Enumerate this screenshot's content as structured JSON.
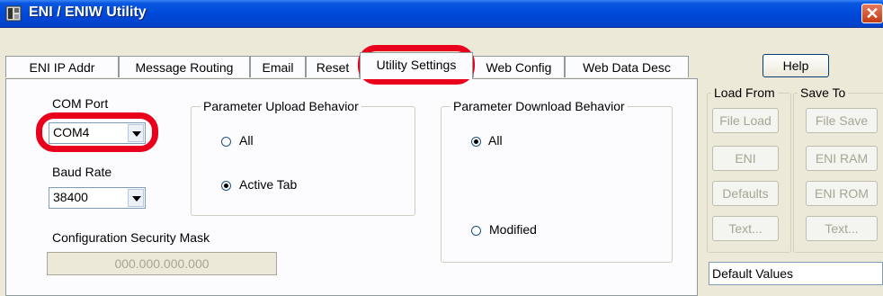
{
  "window": {
    "title": "ENI / ENIW Utility",
    "close_symbol": "✕"
  },
  "tabs": [
    {
      "label": "ENI IP Addr"
    },
    {
      "label": "Message Routing"
    },
    {
      "label": "Email"
    },
    {
      "label": "Reset"
    },
    {
      "label": "Utility Settings",
      "active": true
    },
    {
      "label": "Web Config"
    },
    {
      "label": "Web Data Desc"
    }
  ],
  "help_label": "Help",
  "com_port": {
    "label": "COM Port",
    "value": "COM4"
  },
  "baud_rate": {
    "label": "Baud Rate",
    "value": "38400"
  },
  "security_mask": {
    "label": "Configuration Security Mask",
    "value": "000.000.000.000"
  },
  "upload": {
    "title": "Parameter Upload Behavior",
    "options": [
      {
        "label": "All",
        "selected": false
      },
      {
        "label": "Active Tab",
        "selected": true
      }
    ]
  },
  "download": {
    "title": "Parameter Download Behavior",
    "options": [
      {
        "label": "All",
        "selected": true
      },
      {
        "label": "Modified",
        "selected": false
      }
    ]
  },
  "load_from": {
    "title": "Load From",
    "buttons": [
      "File Load",
      "ENI",
      "Defaults",
      "Text..."
    ]
  },
  "save_to": {
    "title": "Save To",
    "buttons": [
      "File Save",
      "ENI RAM",
      "ENI ROM",
      "Text..."
    ]
  },
  "status_text": "Default Values",
  "colors": {
    "title_bar": "#0048d8",
    "highlight": "#e8001c",
    "face": "#ece9d8"
  },
  "icons": {
    "app": "app-icon",
    "close": "close-icon",
    "dropdown": "chevron-down-icon"
  }
}
